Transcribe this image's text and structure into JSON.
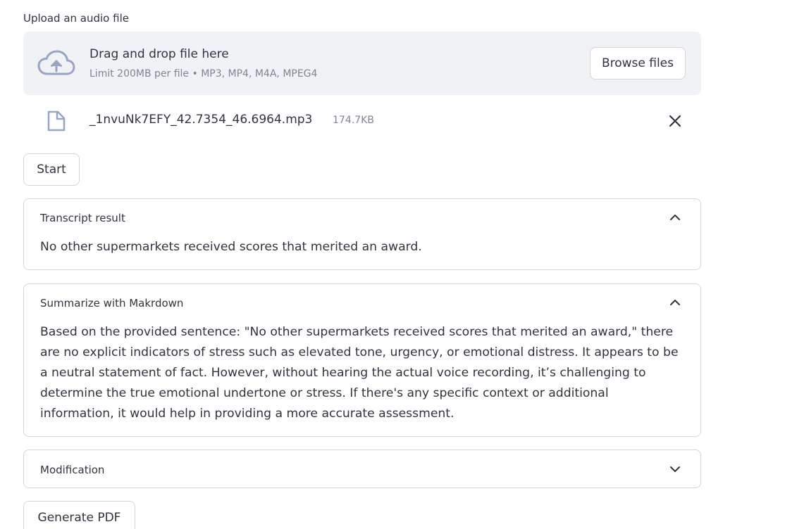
{
  "uploader": {
    "label": "Upload an audio file",
    "drop_title": "Drag and drop file here",
    "limit_text": "Limit 200MB per file • MP3, MP4, M4A, MPEG4",
    "browse_label": "Browse files",
    "icon": "cloud-upload-icon"
  },
  "uploaded_file": {
    "name": "_1nvuNk7EFY_42.7354_46.6964.mp3",
    "size": "174.7KB",
    "icon": "file-icon",
    "remove_icon": "close-icon"
  },
  "start_button": {
    "label": "Start"
  },
  "expanders": {
    "transcript": {
      "title": "Transcript result",
      "expanded": true,
      "content": "No other supermarkets received scores that merited an award."
    },
    "summary": {
      "title": "Summarize with Makrdown",
      "expanded": true,
      "content": "Based on the provided sentence: \"No other supermarkets received scores that merited an award,\" there are no explicit indicators of stress such as elevated tone, urgency, or emotional distress. It appears to be a neutral statement of fact. However, without hearing the actual voice recording, it’s challenging to determine the true emotional undertone or stress. If there's any specific context or additional information, it would help in providing a more accurate assessment."
    },
    "modification": {
      "title": "Modification",
      "expanded": false
    }
  },
  "pdf_button": {
    "label": "Generate PDF"
  },
  "colors": {
    "text": "#31333f",
    "muted": "#808495",
    "dropzone_bg": "#f0f2f6",
    "border": "#d6d6d9"
  }
}
